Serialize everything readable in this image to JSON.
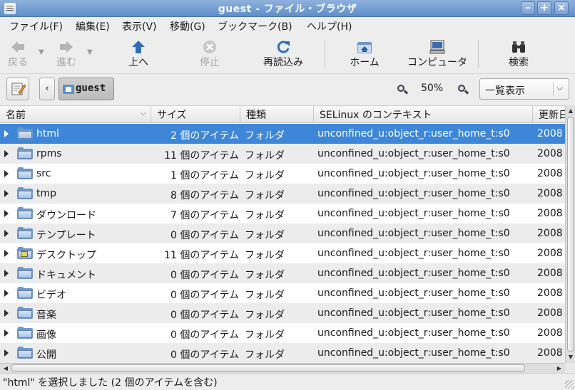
{
  "window": {
    "title": "guest - ファイル・ブラウザ"
  },
  "menu": [
    "ファイル(F)",
    "編集(E)",
    "表示(V)",
    "移動(G)",
    "ブックマーク(B)",
    "ヘルプ(H)"
  ],
  "toolbar": {
    "back": "戻る",
    "forward": "進む",
    "up": "上へ",
    "stop": "停止",
    "reload": "再読込み",
    "home": "ホーム",
    "computer": "コンピュータ",
    "search": "検索"
  },
  "location": {
    "crumb": "guest",
    "zoom": "50%",
    "view_mode": "一覧表示"
  },
  "columns": {
    "name": "名前",
    "size": "サイズ",
    "type": "種類",
    "context": "SELinux のコンテキスト",
    "date": "更新日"
  },
  "rows": [
    {
      "name": "html",
      "size": "2 個のアイテム",
      "type": "フォルダ",
      "context": "unconfined_u:object_r:user_home_t:s0",
      "date": "2008",
      "icon": "folder-icon",
      "selected": true
    },
    {
      "name": "rpms",
      "size": "11 個のアイテム",
      "type": "フォルダ",
      "context": "unconfined_u:object_r:user_home_t:s0",
      "date": "2008",
      "icon": "folder-icon"
    },
    {
      "name": "src",
      "size": "1 個のアイテム",
      "type": "フォルダ",
      "context": "unconfined_u:object_r:user_home_t:s0",
      "date": "2008",
      "icon": "folder-icon"
    },
    {
      "name": "tmp",
      "size": "8 個のアイテム",
      "type": "フォルダ",
      "context": "unconfined_u:object_r:user_home_t:s0",
      "date": "2008",
      "icon": "folder-icon"
    },
    {
      "name": "ダウンロード",
      "size": "7 個のアイテム",
      "type": "フォルダ",
      "context": "unconfined_u:object_r:user_home_t:s0",
      "date": "2008",
      "icon": "folder-icon"
    },
    {
      "name": "テンプレート",
      "size": "0 個のアイテム",
      "type": "フォルダ",
      "context": "unconfined_u:object_r:user_home_t:s0",
      "date": "2008",
      "icon": "folder-icon"
    },
    {
      "name": "デスクトップ",
      "size": "11 個のアイテム",
      "type": "フォルダ",
      "context": "unconfined_u:object_r:user_home_t:s0",
      "date": "2008",
      "icon": "desktop-folder-icon"
    },
    {
      "name": "ドキュメント",
      "size": "0 個のアイテム",
      "type": "フォルダ",
      "context": "unconfined_u:object_r:user_home_t:s0",
      "date": "2008",
      "icon": "folder-icon"
    },
    {
      "name": "ビデオ",
      "size": "0 個のアイテム",
      "type": "フォルダ",
      "context": "unconfined_u:object_r:user_home_t:s0",
      "date": "2008",
      "icon": "folder-icon"
    },
    {
      "name": "音楽",
      "size": "0 個のアイテム",
      "type": "フォルダ",
      "context": "unconfined_u:object_r:user_home_t:s0",
      "date": "2008",
      "icon": "folder-icon"
    },
    {
      "name": "画像",
      "size": "0 個のアイテム",
      "type": "フォルダ",
      "context": "unconfined_u:object_r:user_home_t:s0",
      "date": "2008",
      "icon": "folder-icon"
    },
    {
      "name": "公開",
      "size": "0 個のアイテム",
      "type": "フォルダ",
      "context": "unconfined_u:object_r:user_home_t:s0",
      "date": "2008",
      "icon": "folder-icon"
    }
  ],
  "status": "\"html\" を選択しました (2 個のアイテムを含む)",
  "colors": {
    "selection": "#3d86d8",
    "titlebar": "#6f98cf",
    "folder": "#6f96c6"
  }
}
